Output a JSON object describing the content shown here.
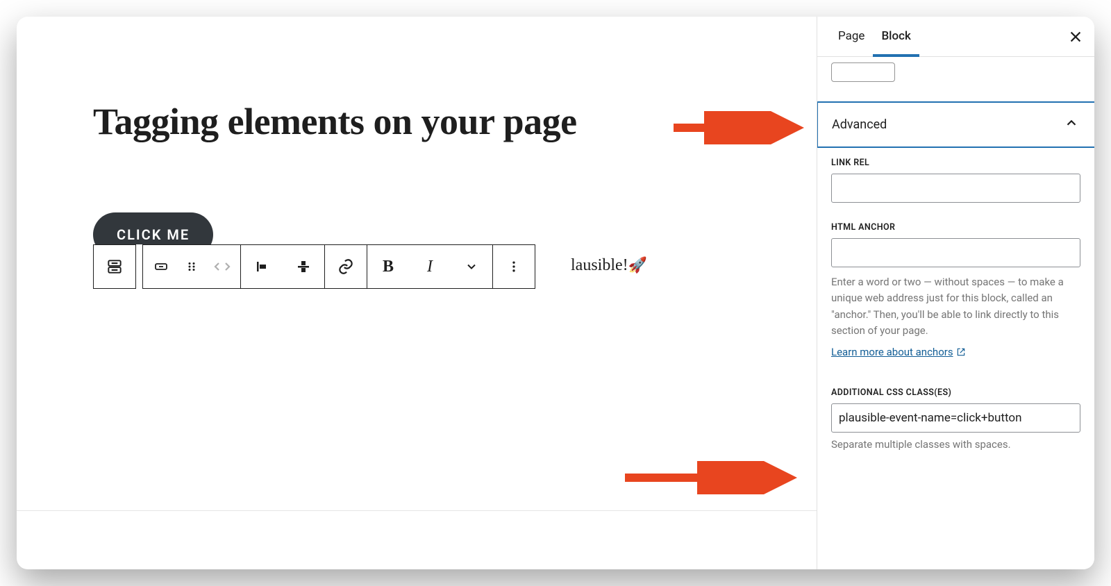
{
  "sidebar": {
    "tabs": {
      "page": "Page",
      "block": "Block",
      "active": "Block"
    },
    "panel": "Advanced",
    "linkrel": {
      "label": "LINK REL",
      "value": ""
    },
    "anchor": {
      "label": "HTML ANCHOR",
      "value": "",
      "help": "Enter a word or two — without spaces — to make a unique web address just for this block, called an \"anchor.\" Then, you'll be able to link directly to this section of your page.",
      "learn": "Learn more about anchors"
    },
    "css": {
      "label": "ADDITIONAL CSS CLASS(ES)",
      "value": "plausible-event-name=click+button",
      "help": "Separate multiple classes with spaces."
    }
  },
  "editor": {
    "title": "Tagging elements on your page",
    "fragment_text": "lausible!",
    "cta": "CLICK ME"
  }
}
